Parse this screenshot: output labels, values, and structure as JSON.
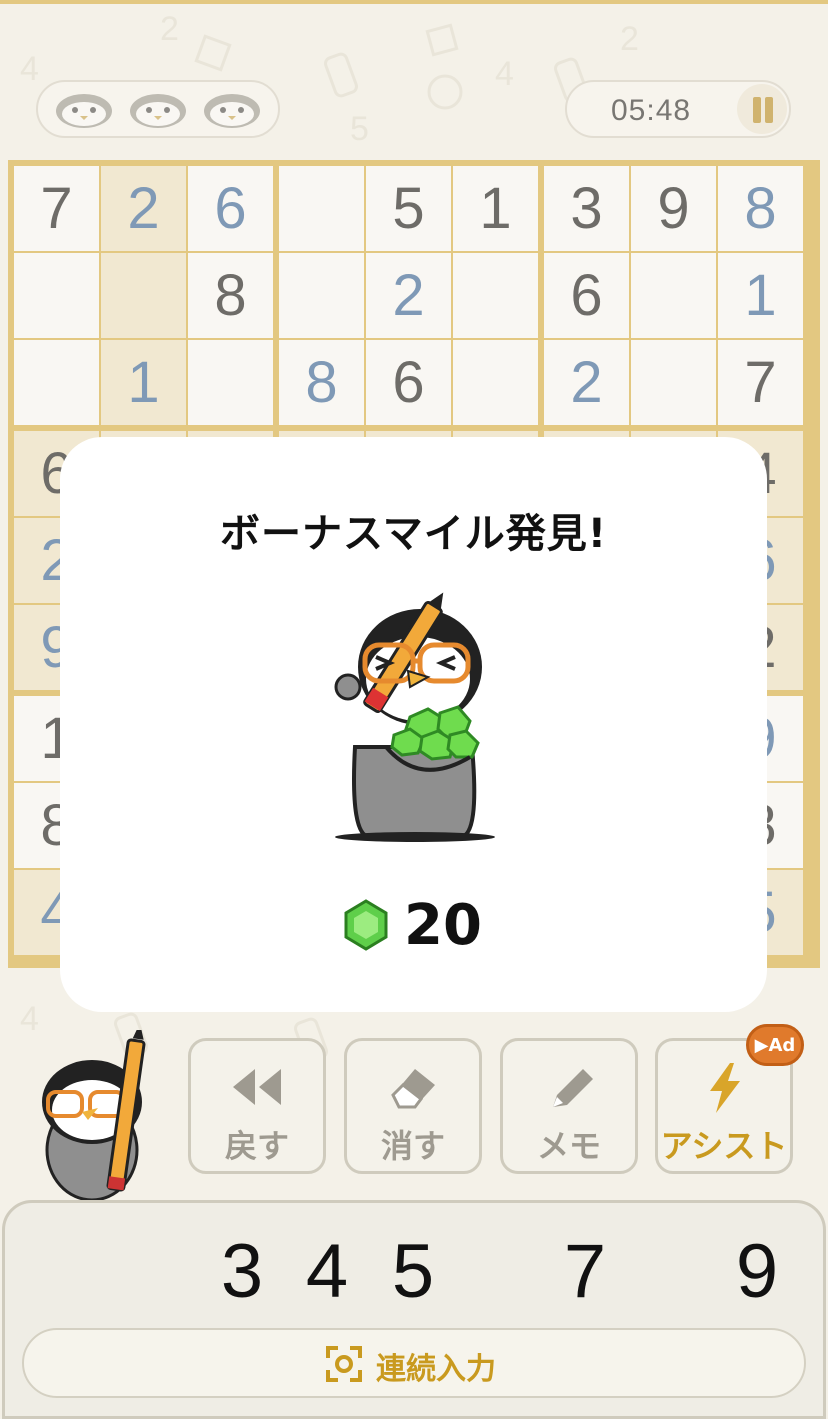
{
  "header": {
    "lives_icon": "penguin-face-icon",
    "lives_count": 3,
    "timer": "05:48",
    "pause_icon": "pause-icon"
  },
  "board": {
    "grid": [
      [
        "7",
        "2",
        "6",
        "",
        "5",
        "1",
        "3",
        "9",
        "8"
      ],
      [
        "",
        "",
        "8",
        "",
        "2",
        "",
        "6",
        "",
        "1"
      ],
      [
        "",
        "1",
        "",
        "8",
        "6",
        "",
        "2",
        "",
        "7"
      ],
      [
        "6",
        "",
        "",
        "",
        "",
        "",
        "",
        "",
        "4"
      ],
      [
        "2",
        "",
        "",
        "",
        "",
        "",
        "",
        "",
        "6"
      ],
      [
        "9",
        "",
        "",
        "",
        "",
        "",
        "",
        "",
        "2"
      ],
      [
        "1",
        "",
        "",
        "",
        "",
        "",
        "",
        "",
        "9"
      ],
      [
        "8",
        "",
        "",
        "",
        "",
        "",
        "",
        "",
        "8"
      ],
      [
        "4",
        "",
        "",
        "",
        "",
        "",
        "",
        "",
        "5"
      ]
    ],
    "user_entries": [
      [
        0,
        1
      ],
      [
        0,
        2
      ],
      [
        0,
        8
      ],
      [
        1,
        4
      ],
      [
        1,
        8
      ],
      [
        2,
        1
      ],
      [
        2,
        3
      ],
      [
        2,
        6
      ],
      [
        4,
        0
      ],
      [
        4,
        8
      ],
      [
        5,
        0
      ],
      [
        6,
        8
      ],
      [
        8,
        0
      ],
      [
        8,
        8
      ]
    ],
    "highlight_color": "#f2e6c4",
    "user_color": "#2e5e96"
  },
  "modal": {
    "title": "ボーナスマイル発見!",
    "reward_icon": "gem-icon",
    "reward_amount": "20"
  },
  "controls": {
    "undo": "戻す",
    "erase": "消す",
    "memo": "メモ",
    "assist": "アシスト",
    "ad_badge": "▶Ad"
  },
  "numpad": {
    "numbers": [
      "3",
      "4",
      "5",
      "7",
      "9"
    ],
    "continuous_label": "連続入力"
  },
  "colors": {
    "accent": "#d9ae3c",
    "assist": "#c99a1f"
  }
}
